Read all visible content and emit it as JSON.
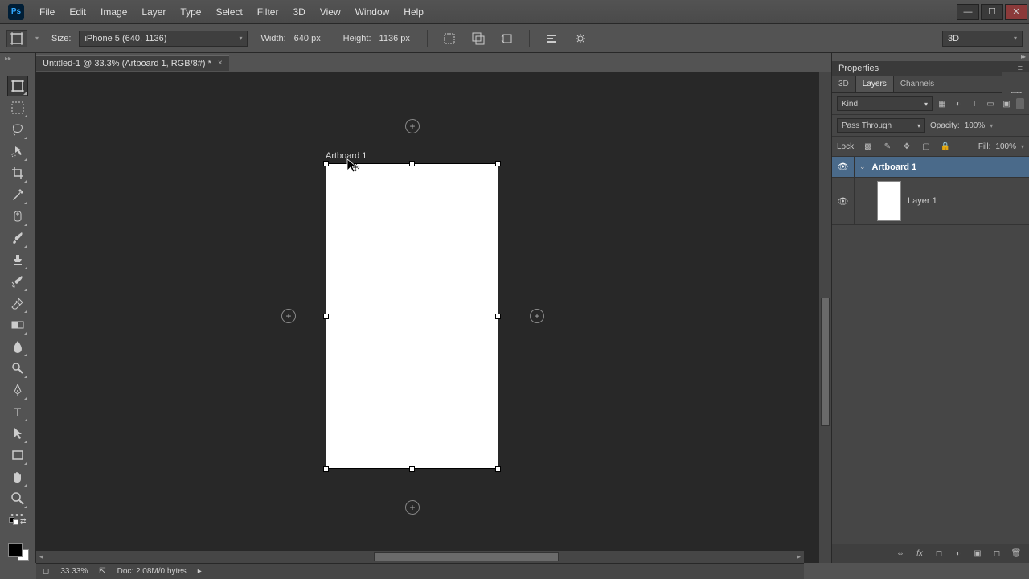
{
  "app": {
    "logo_text": "Ps"
  },
  "menu": [
    "File",
    "Edit",
    "Image",
    "Layer",
    "Type",
    "Select",
    "Filter",
    "3D",
    "View",
    "Window",
    "Help"
  ],
  "options": {
    "size_label": "Size:",
    "size_preset": "iPhone 5 (640, 1136)",
    "width_label": "Width:",
    "width_value": "640 px",
    "height_label": "Height:",
    "height_value": "1136 px",
    "right_dropdown": "3D"
  },
  "document": {
    "tab_title": "Untitled-1 @ 33.3% (Artboard 1, RGB/8#) *",
    "artboard_name": "Artboard 1"
  },
  "properties": {
    "panel_title": "Properties",
    "tabs": [
      "3D",
      "Layers",
      "Channels"
    ],
    "active_tab": "Layers",
    "kind_label": "Kind",
    "blend_mode": "Pass Through",
    "opacity_label": "Opacity:",
    "opacity_value": "100%",
    "lock_label": "Lock:",
    "fill_label": "Fill:",
    "fill_value": "100%",
    "layers": [
      {
        "name": "Artboard 1",
        "is_group": true,
        "selected": true
      },
      {
        "name": "Layer 1",
        "is_group": false,
        "selected": false
      }
    ]
  },
  "status": {
    "zoom": "33.33%",
    "doc_info": "Doc: 2.08M/0 bytes"
  },
  "icons": {
    "artboard_tool": "artboard",
    "chevron": "▾",
    "chevron_right": "▸",
    "close_x": "×",
    "plus": "+"
  }
}
